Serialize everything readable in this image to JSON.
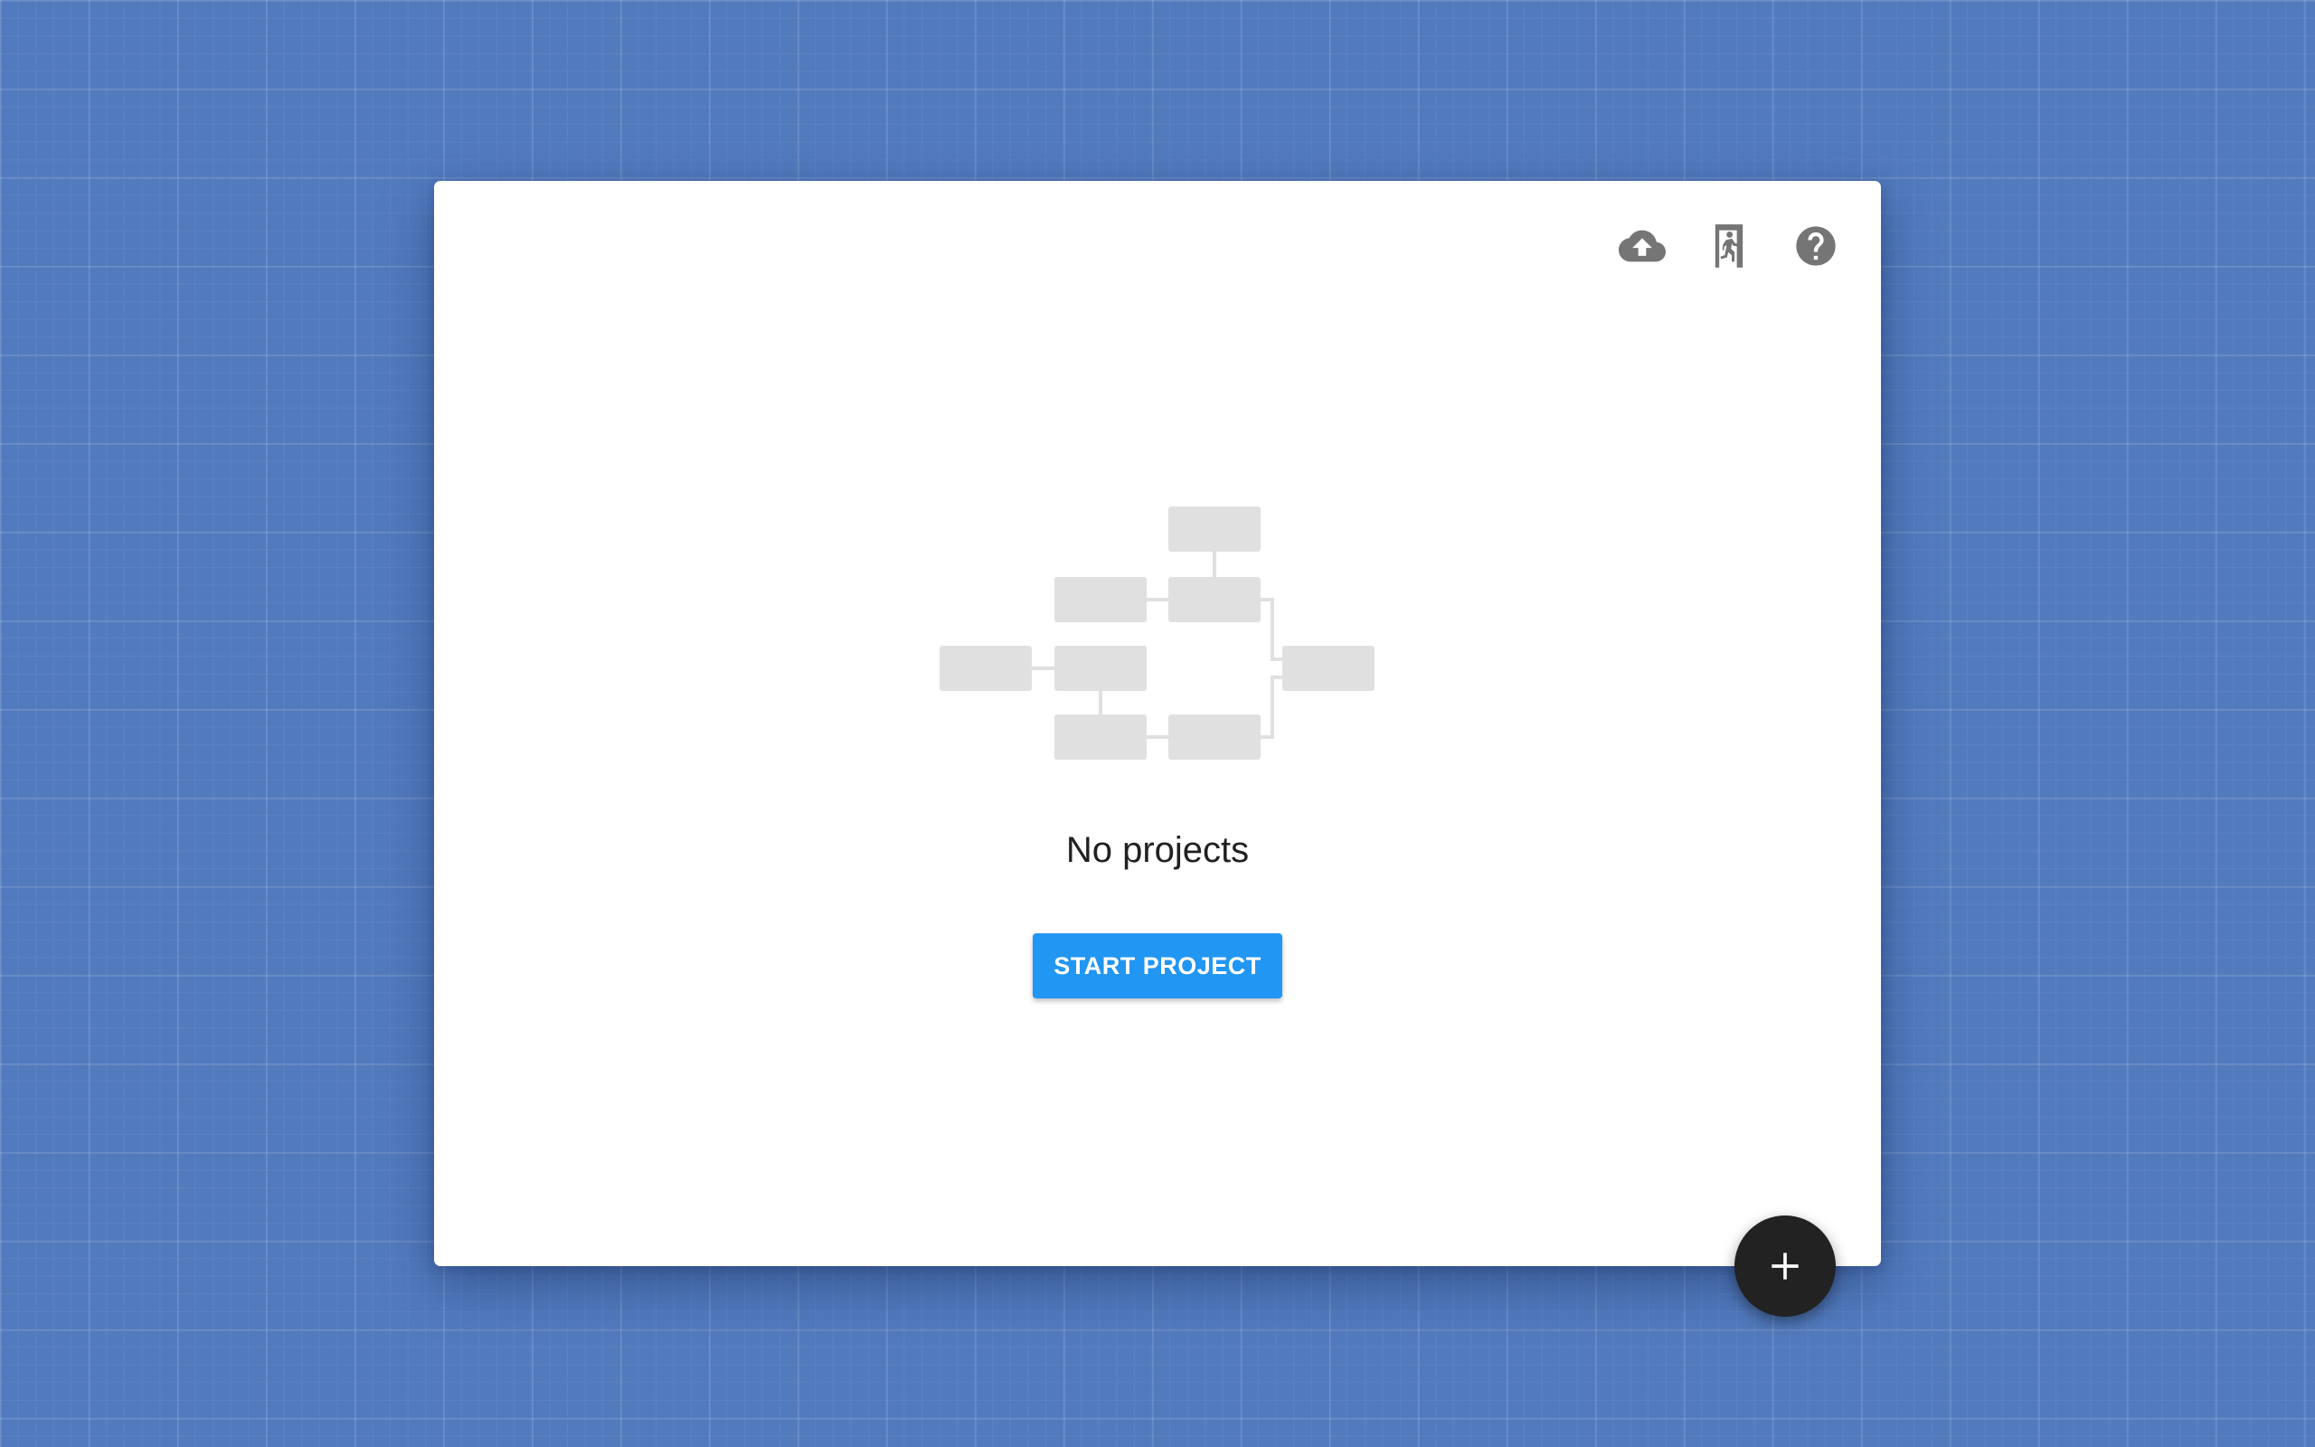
{
  "toolbar": {
    "icons": [
      "cloud-upload-icon",
      "exit-icon",
      "help-icon"
    ]
  },
  "empty_state": {
    "title": "No projects",
    "button_label": "START PROJECT"
  },
  "fab": {
    "icon": "plus-icon"
  },
  "colors": {
    "background": "#527bbe",
    "card": "#ffffff",
    "primary": "#2196f3",
    "fab": "#222222",
    "icon": "#757575",
    "diagram_box": "#e0e0e0"
  }
}
